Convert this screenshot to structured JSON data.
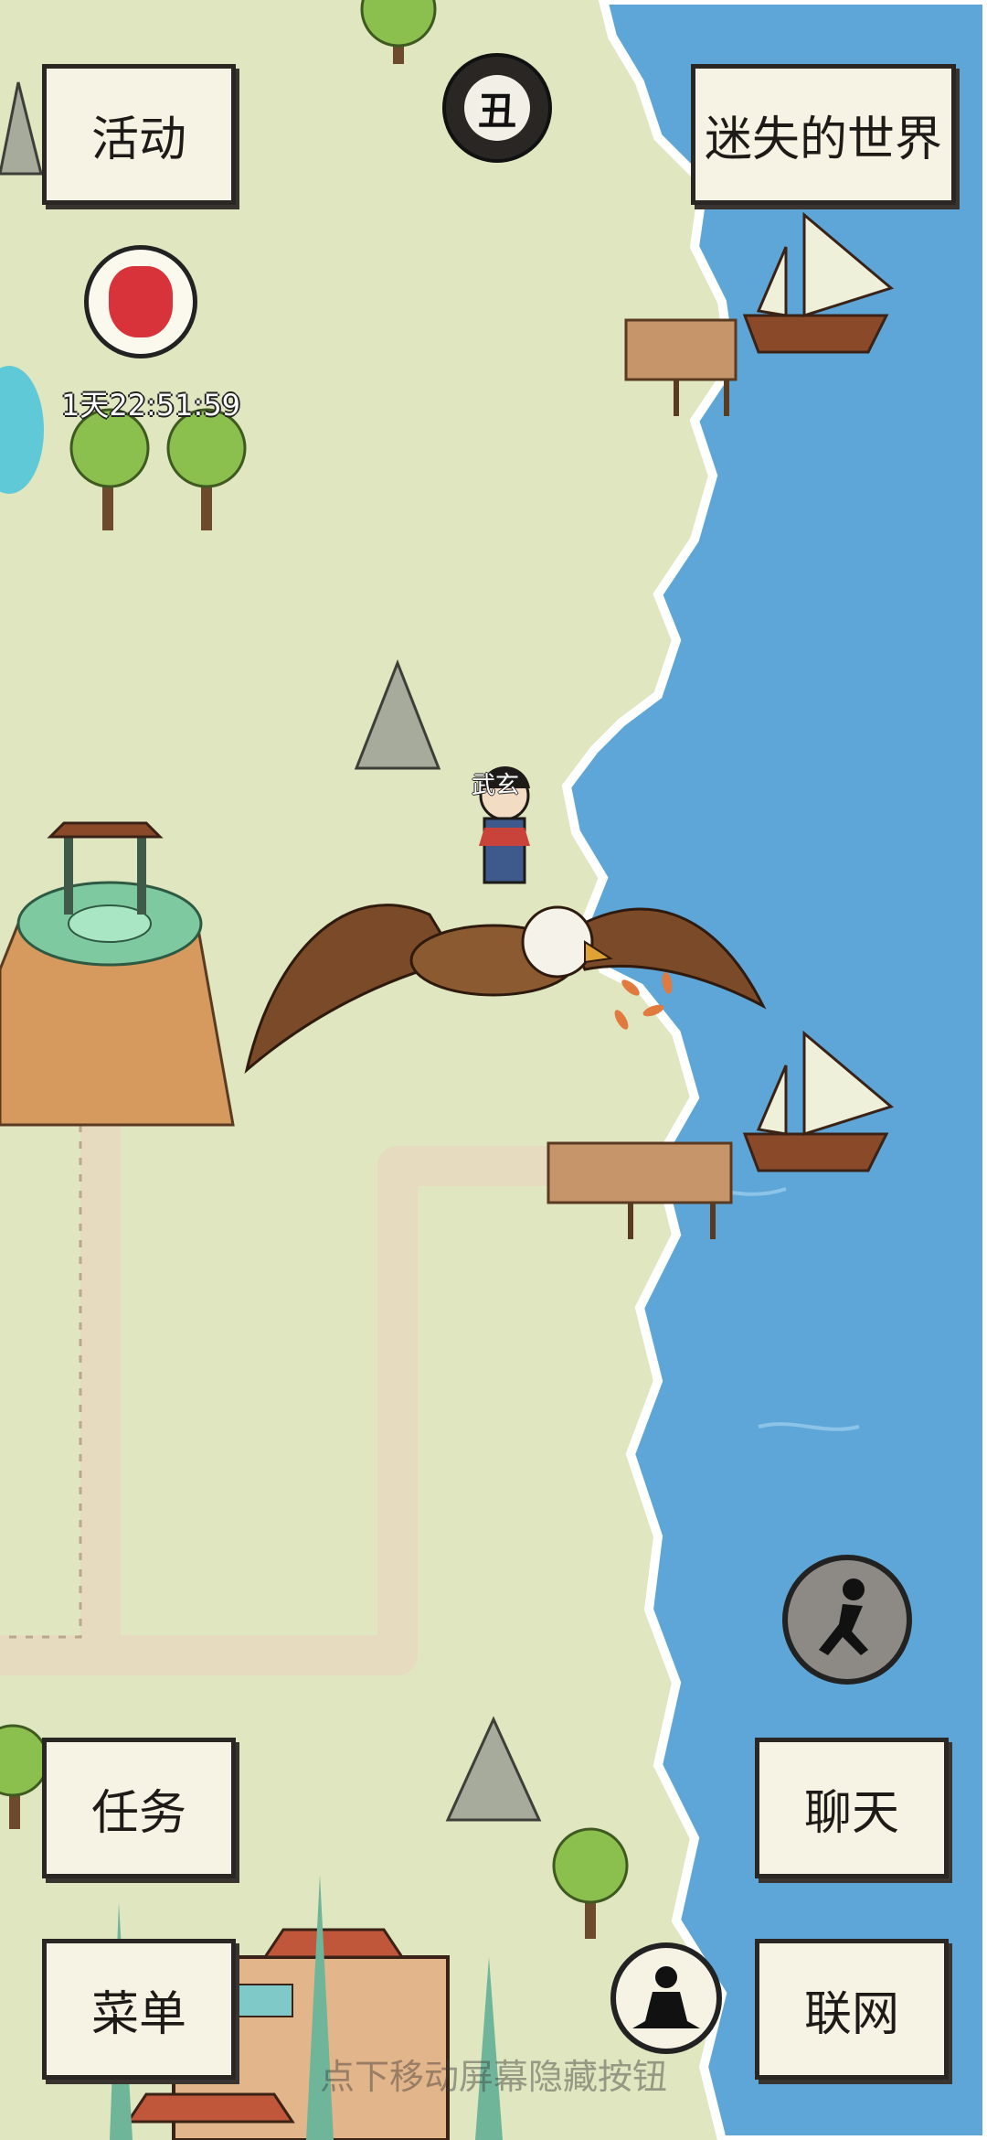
{
  "buttons": {
    "activity": "活动",
    "lost_world": "迷失的世界",
    "task": "任务",
    "chat": "聊天",
    "menu": "菜单",
    "online": "联网"
  },
  "day_badge": "丑",
  "event_timer": "1天22:51:59",
  "player_name": "武玄",
  "hint_text": "点下移动屏幕隐藏按钮",
  "icons": {
    "time": "moon-phase-icon",
    "event": "red-pouch-icon",
    "run": "running-man-icon",
    "meditate": "meditation-icon"
  },
  "colors": {
    "grass": "#dfe6c0",
    "sea": "#5ea6d8",
    "path": "#e6dbbf",
    "button_bg": "#f6f2e4"
  }
}
